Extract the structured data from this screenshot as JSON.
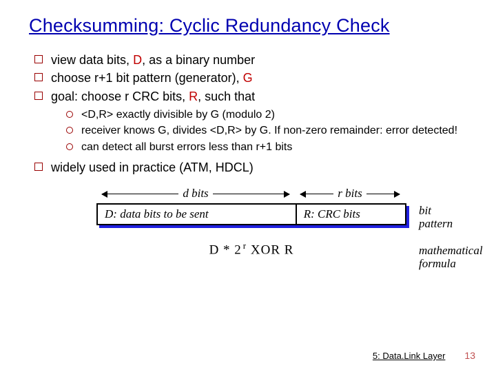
{
  "title": "Checksumming: Cyclic Redundancy Check",
  "bullets": {
    "b1a": "view data bits, ",
    "b1b": "D",
    "b1c": ", as a binary number",
    "b2a": "choose r+1 bit pattern (generator), ",
    "b2b": "G",
    "b3a": "goal: choose r CRC bits, ",
    "b3b": "R",
    "b3c": ", such that",
    "s1": "<D,R> exactly divisible by G (modulo 2)",
    "s2": "receiver knows G, divides <D,R> by G.  If non-zero remainder: error detected!",
    "s3": "can detect all burst errors less than r+1 bits",
    "b4": "widely used in practice (ATM, HDCL)"
  },
  "diagram": {
    "dbits": "d bits",
    "rbits": "r bits",
    "box_left": "D: data bits to be sent",
    "box_right": "R: CRC bits",
    "side_bit": "bit pattern",
    "side_formula": "mathematical formula",
    "formula_d": "D * 2",
    "formula_exp": "r",
    "formula_rest": "   XOR   R"
  },
  "footer": {
    "chapter": "5: Data.Link Layer",
    "page": "13"
  }
}
